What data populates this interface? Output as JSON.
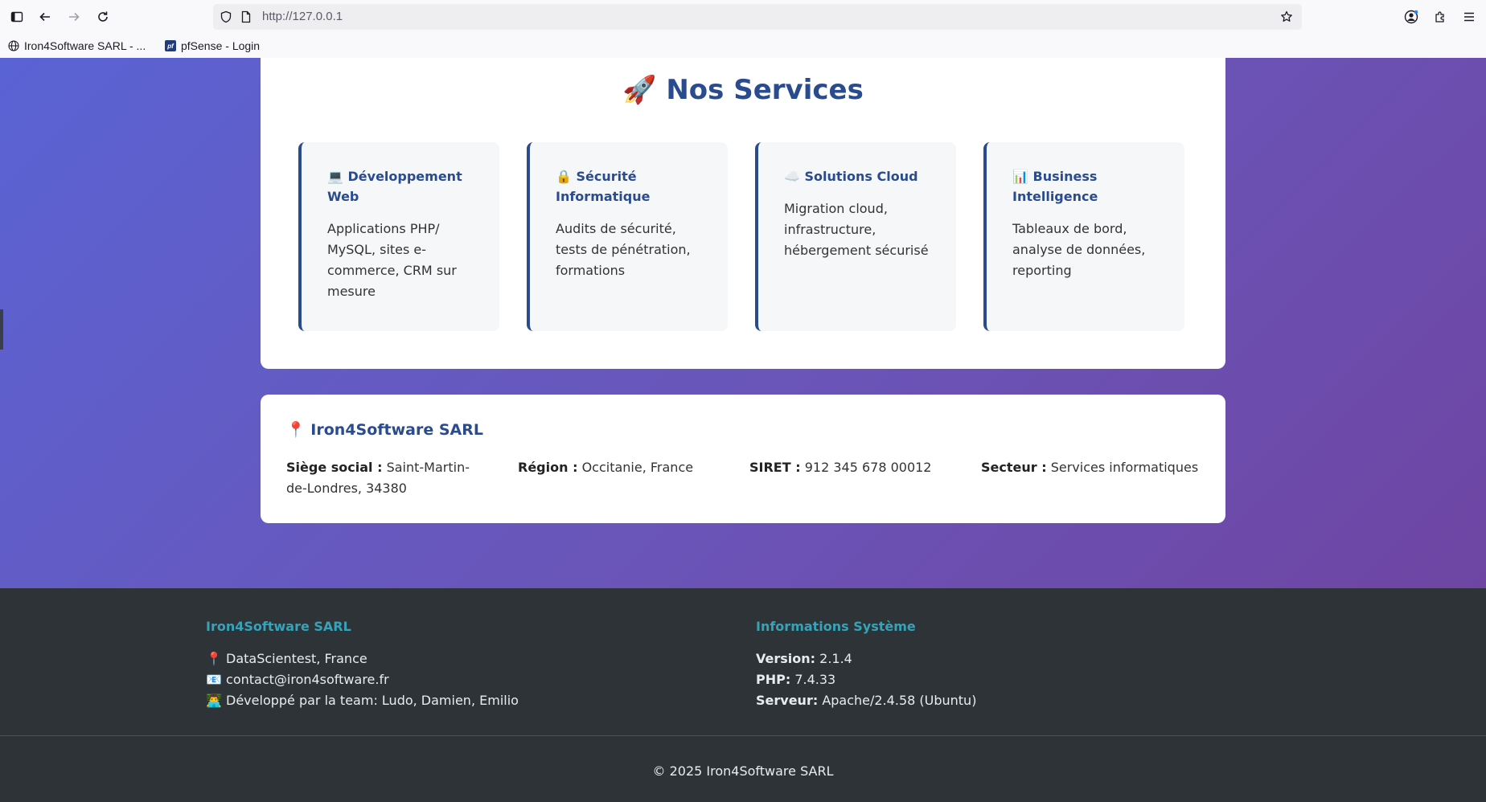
{
  "browser": {
    "url": "http://127.0.0.1",
    "bookmarks": [
      {
        "label": "Iron4Software SARL - ..."
      },
      {
        "label": "pfSense - Login",
        "badge": "pf"
      }
    ]
  },
  "services": {
    "icon": "🚀",
    "title": "Nos Services",
    "items": [
      {
        "icon": "💻",
        "title": "Développement Web",
        "description": "Applications PHP/ MySQL, sites e-commerce, CRM sur mesure"
      },
      {
        "icon": "🔒",
        "title": "Sécurité Informatique",
        "description": "Audits de sécurité, tests de pénétration, formations"
      },
      {
        "icon": "☁️",
        "title": "Solutions Cloud",
        "description": "Migration cloud, infrastructure, hébergement sécurisé"
      },
      {
        "icon": "📊",
        "title": "Business Intelligence",
        "description": "Tableaux de bord, analyse de données, reporting"
      }
    ]
  },
  "company": {
    "icon": "📍",
    "title": "Iron4Software SARL",
    "fields": [
      {
        "label": "Siège social :",
        "value": "Saint-Martin-de-Londres, 34380"
      },
      {
        "label": "Région :",
        "value": "Occitanie, France"
      },
      {
        "label": "SIRET :",
        "value": "912 345 678 00012"
      },
      {
        "label": "Secteur :",
        "value": "Services informatiques"
      }
    ]
  },
  "footer": {
    "left": {
      "heading": "Iron4Software SARL",
      "lines": [
        {
          "icon": "📍",
          "text": "DataScientest, France"
        },
        {
          "icon": "📧",
          "text": "contact@iron4software.fr"
        },
        {
          "icon": "👨‍💻",
          "text": "Développé par la team: Ludo, Damien, Emilio"
        }
      ]
    },
    "right": {
      "heading": "Informations Système",
      "lines": [
        {
          "label": "Version:",
          "value": "2.1.4"
        },
        {
          "label": "PHP:",
          "value": "7.4.33"
        },
        {
          "label": "Serveur:",
          "value": "Apache/2.4.58 (Ubuntu)"
        }
      ]
    },
    "copyright": "© 2025 Iron4Software SARL"
  },
  "colors": {
    "accent": "#2a4b8d",
    "footer_heading": "#36a3b8",
    "footer_bg": "#2e3338",
    "gradient_start": "#5a63d4",
    "gradient_end": "#6e45a3"
  }
}
